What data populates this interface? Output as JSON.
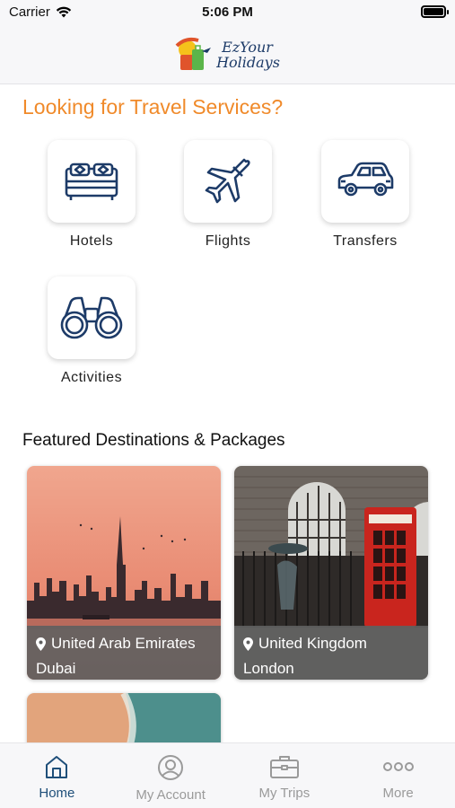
{
  "status_bar": {
    "carrier": "Carrier",
    "time": "5:06 PM"
  },
  "header": {
    "logo_line1": "EzYour",
    "logo_line2": "Holidays"
  },
  "services": {
    "title": "Looking for Travel Services?",
    "items": [
      {
        "label": "Hotels",
        "icon": "bed-icon"
      },
      {
        "label": "Flights",
        "icon": "airplane-icon"
      },
      {
        "label": "Transfers",
        "icon": "car-icon"
      },
      {
        "label": "Activities",
        "icon": "binoculars-icon"
      }
    ]
  },
  "featured": {
    "title": "Featured Destinations & Packages",
    "cards": [
      {
        "country": "United Arab Emirates",
        "city": "Dubai"
      },
      {
        "country": "United Kingdom",
        "city": "London"
      }
    ]
  },
  "tabbar": {
    "items": [
      {
        "label": "Home",
        "icon": "home-icon",
        "active": true
      },
      {
        "label": "My Account",
        "icon": "account-icon",
        "active": false
      },
      {
        "label": "My Trips",
        "icon": "briefcase-icon",
        "active": false
      },
      {
        "label": "More",
        "icon": "more-icon",
        "active": false
      }
    ]
  },
  "colors": {
    "accent": "#f08a2a",
    "icon_navy": "#1d3b68",
    "tab_active": "#1f4f7a"
  }
}
